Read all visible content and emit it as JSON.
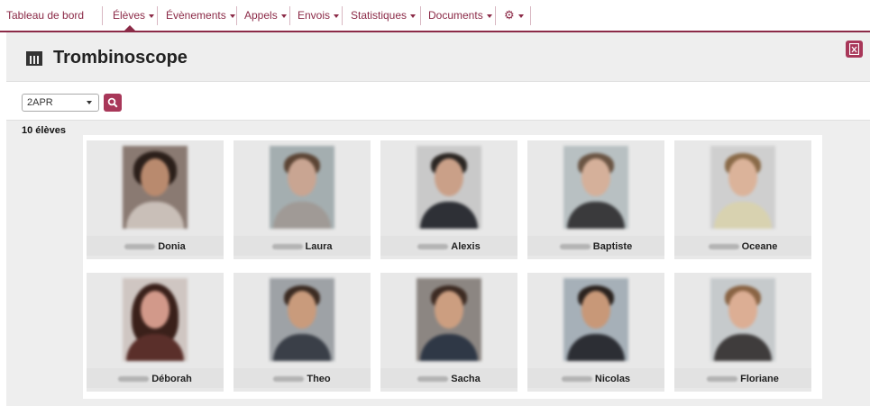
{
  "nav": {
    "items": [
      {
        "label": "Tableau de bord",
        "dropdown": false
      },
      {
        "label": "Élèves",
        "dropdown": true
      },
      {
        "label": "Évènements",
        "dropdown": true
      },
      {
        "label": "Appels",
        "dropdown": true
      },
      {
        "label": "Envois",
        "dropdown": true
      },
      {
        "label": "Statistiques",
        "dropdown": true
      },
      {
        "label": "Documents",
        "dropdown": true
      }
    ],
    "settings_icon": "gear-icon",
    "active": "Élèves"
  },
  "page": {
    "title": "Trombinoscope",
    "title_icon": "calendar-icon",
    "export_icon": "spreadsheet-export-icon"
  },
  "filter": {
    "class_value": "2APR",
    "search_icon": "search-icon"
  },
  "count_label": "10 élèves",
  "students": [
    {
      "first_name": "Donia"
    },
    {
      "first_name": "Laura"
    },
    {
      "first_name": "Alexis"
    },
    {
      "first_name": "Baptiste"
    },
    {
      "first_name": "Oceane"
    },
    {
      "first_name": "Déborah"
    },
    {
      "first_name": "Theo"
    },
    {
      "first_name": "Sacha"
    },
    {
      "first_name": "Nicolas"
    },
    {
      "first_name": "Floriane"
    }
  ],
  "colors": {
    "accent": "#8b2a47",
    "button": "#a83759",
    "page_bg": "#eeeeee"
  }
}
